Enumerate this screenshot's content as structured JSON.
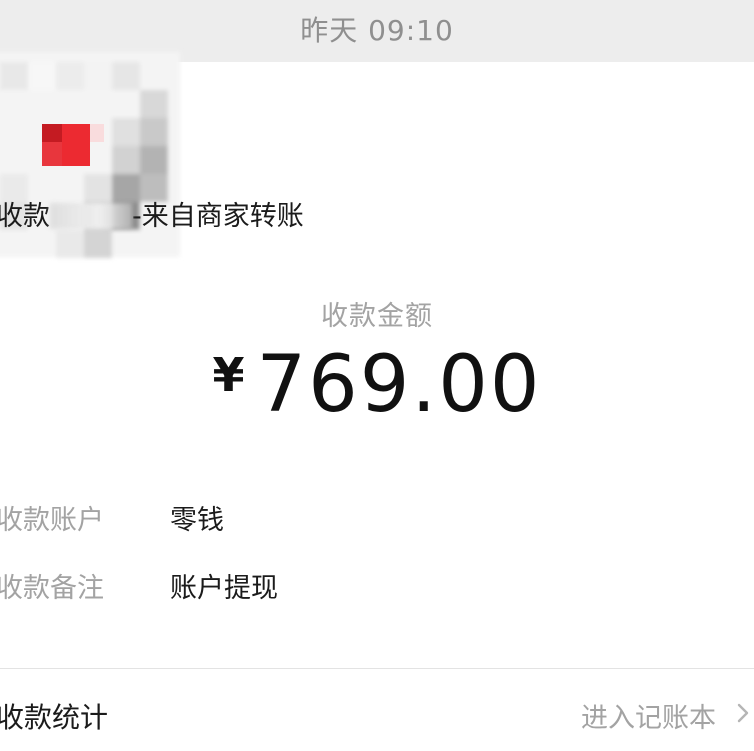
{
  "timestamp": "昨天 09:10",
  "notification": {
    "title_prefix": "收款",
    "title_suffix": "-来自商家转账"
  },
  "amount": {
    "label": "收款金额",
    "currency": "¥",
    "value": "769.00"
  },
  "details": [
    {
      "label": "收款账户",
      "value": "零钱"
    },
    {
      "label": "收款备注",
      "value": "账户提现"
    }
  ],
  "stats": {
    "label": "收款统计",
    "link": "进入记账本"
  },
  "icons": {
    "avatar": "blurred-avatar-icon",
    "chevron": "chevron-right-icon"
  },
  "colors": {
    "timestamp_bar": "#ededed",
    "muted_text": "#a3a3a3",
    "primary_text": "#111111",
    "avatar_red": "#e8242c"
  }
}
